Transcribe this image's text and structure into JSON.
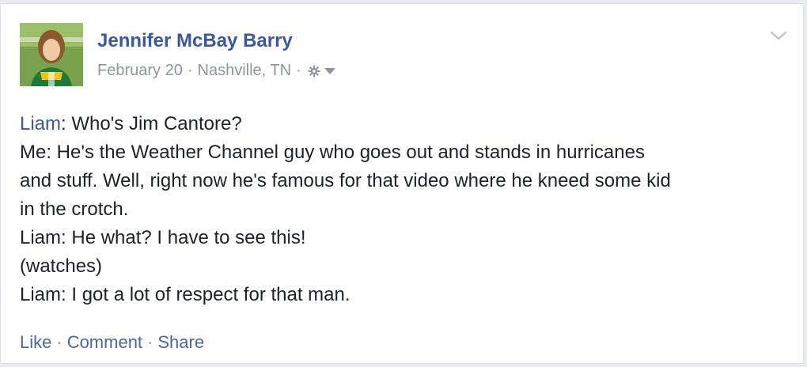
{
  "post": {
    "author": "Jennifer McBay Barry",
    "date": "February 20",
    "location": "Nashville, TN",
    "separator": "·",
    "privacy_icon": "gear-icon",
    "menu_icon": "chevron-down-icon",
    "body_lines": [
      {
        "speaker": "Liam",
        "text": ": Who's Jim Cantore?"
      },
      {
        "text": "Me: He's the Weather Channel guy who goes out and stands in hurricanes"
      },
      {
        "text": "and stuff. Well, right now he's famous for that video where he kneed some kid"
      },
      {
        "text": "in the crotch."
      },
      {
        "text": "Liam: He what? I have to see this!"
      },
      {
        "text": "(watches)"
      },
      {
        "text": "Liam: I got a lot of respect for that man."
      }
    ],
    "actions": {
      "like": "Like",
      "comment": "Comment",
      "share": "Share"
    }
  },
  "colors": {
    "link": "#3b5998",
    "meta": "#90949c",
    "text": "#1d2129",
    "action": "#4b67a1"
  }
}
